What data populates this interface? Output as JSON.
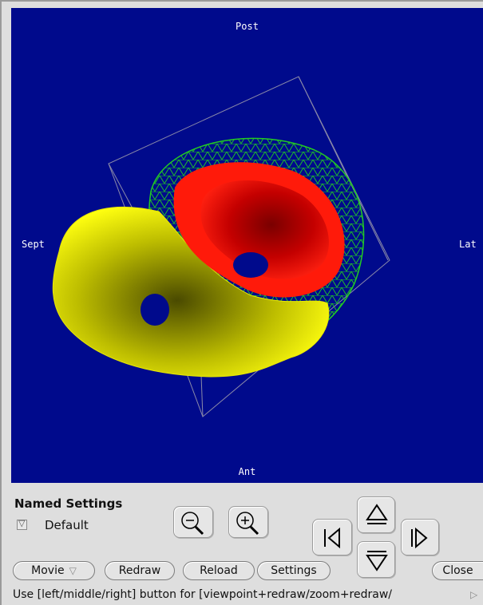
{
  "viewer": {
    "orientation": {
      "top": "Post",
      "bottom": "Ant",
      "left": "Sept",
      "right": "Lat"
    },
    "background_color": "#000a8c",
    "colors": {
      "left_ventricle": "#ff1a0a",
      "right_ventricle": "#f4f200",
      "epicardium_mesh": "#22cc22",
      "bounding_box": "#8a8aa8"
    }
  },
  "named_settings": {
    "title": "Named Settings",
    "selected": "Default",
    "dropdown_icon": "triangle-down-icon"
  },
  "zoom": {
    "out_icon": "zoom-out-icon",
    "in_icon": "zoom-in-icon"
  },
  "rotate": {
    "up_icon": "arrow-up-icon",
    "down_icon": "arrow-down-icon",
    "left_icon": "arrow-left-icon",
    "right_icon": "arrow-right-icon"
  },
  "buttons": {
    "movie": "Movie",
    "redraw": "Redraw",
    "reload": "Reload",
    "settings": "Settings",
    "close": "Close"
  },
  "status": "Use [left/middle/right] button for [viewpoint+redraw/zoom+redraw/"
}
